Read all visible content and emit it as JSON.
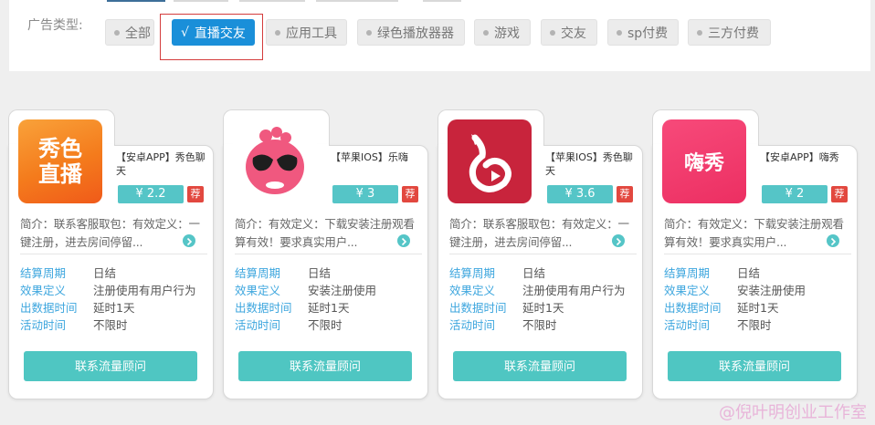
{
  "filter": {
    "label": "广告类型:",
    "options": [
      {
        "label": "全部",
        "active": false
      },
      {
        "label": "直播交友",
        "active": true,
        "check": "√"
      },
      {
        "label": "应用工具",
        "active": false
      },
      {
        "label": "绿色播放器器",
        "active": false
      },
      {
        "label": "游戏",
        "active": false
      },
      {
        "label": "交友",
        "active": false
      },
      {
        "label": "sp付费",
        "active": false
      },
      {
        "label": "三方付费",
        "active": false
      }
    ]
  },
  "cards": [
    {
      "icon": "xiuse-zhibo-app-icon",
      "icon_text_1": "秀色",
      "icon_text_2": "直播",
      "name": "【安卓APP】秀色聊天",
      "price": "¥ 2.2",
      "rec": "荐",
      "desc": "简介：联系客服取包：有效定义：一键注册，进去房间停留...",
      "fields": [
        {
          "k": "结算周期",
          "v": "日结"
        },
        {
          "k": "效果定义",
          "v": "注册使用有用户行为"
        },
        {
          "k": "出数据时间",
          "v": "延时1天"
        },
        {
          "k": "活动时间",
          "v": "不限时"
        }
      ],
      "contact": "联系流量顾问"
    },
    {
      "icon": "lehai-app-icon",
      "name": "【苹果IOS】乐嗨",
      "price": "¥ 3",
      "rec": "荐",
      "desc": "简介：有效定义：下载安装注册观看算有效！要求真实用户...",
      "fields": [
        {
          "k": "结算周期",
          "v": "日结"
        },
        {
          "k": "效果定义",
          "v": "安装注册使用"
        },
        {
          "k": "出数据时间",
          "v": "延时1天"
        },
        {
          "k": "活动时间",
          "v": "不限时"
        }
      ],
      "contact": "联系流量顾问"
    },
    {
      "icon": "xiuse-mermaid-app-icon",
      "name": "【苹果IOS】秀色聊天",
      "price": "¥ 3.6",
      "rec": "荐",
      "desc": "简介：联系客服取包：有效定义：一键注册，进去房间停留...",
      "fields": [
        {
          "k": "结算周期",
          "v": "日结"
        },
        {
          "k": "效果定义",
          "v": "注册使用有用户行为"
        },
        {
          "k": "出数据时间",
          "v": "延时1天"
        },
        {
          "k": "活动时间",
          "v": "不限时"
        }
      ],
      "contact": "联系流量顾问"
    },
    {
      "icon": "haixiu-app-icon",
      "icon_text_1": "嗨秀",
      "name": "【安卓APP】嗨秀",
      "price": "¥ 2",
      "rec": "荐",
      "desc": "简介：有效定义：下载安装注册观看算有效！要求真实用户...",
      "fields": [
        {
          "k": "结算周期",
          "v": "日结"
        },
        {
          "k": "效果定义",
          "v": "安装注册使用"
        },
        {
          "k": "出数据时间",
          "v": "延时1天"
        },
        {
          "k": "活动时间",
          "v": "不限时"
        }
      ],
      "contact": "联系流量顾问"
    }
  ],
  "watermark": "@倪叶明创业工作室"
}
